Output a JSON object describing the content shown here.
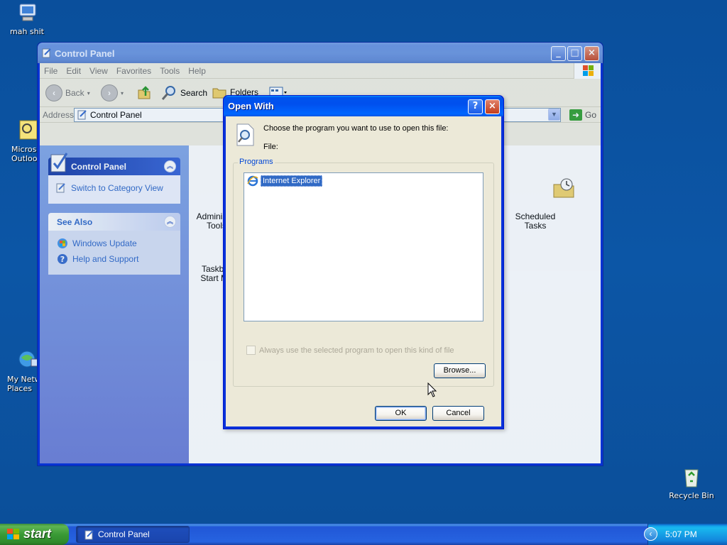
{
  "desktop": {
    "icons": [
      {
        "label": "mah shit",
        "icon": "my-computer-icon"
      },
      {
        "label": "Microsc\nOutloo",
        "icon": "outlook-icon"
      },
      {
        "label": "My Netw\nPlaces",
        "icon": "network-places-icon"
      },
      {
        "label": "Recycle Bin",
        "icon": "recycle-bin-icon"
      }
    ]
  },
  "explorer": {
    "title": "Control Panel",
    "menu": [
      "File",
      "Edit",
      "View",
      "Favorites",
      "Tools",
      "Help"
    ],
    "toolbar": {
      "back": "Back",
      "search": "Search",
      "folders": "Folders"
    },
    "address": {
      "label": "Address",
      "value": "Control Panel",
      "go": "Go"
    },
    "tasks": {
      "panel1": {
        "title": "Control Panel",
        "link": "Switch to Category View"
      },
      "panel2": {
        "title": "See Also",
        "links": [
          "Windows Update",
          "Help and Support"
        ]
      }
    },
    "items": [
      {
        "label": "Administra\nTools"
      },
      {
        "label": "Taskbar\nStart Me"
      },
      {
        "label": "Scheduled\nTasks"
      }
    ]
  },
  "dialog": {
    "title": "Open With",
    "prompt": "Choose the program you want to use to open this file:",
    "file_label": "File:",
    "group_label": "Programs",
    "programs": [
      "Internet Explorer"
    ],
    "always_use": "Always use the selected program to open this kind of file",
    "browse": "Browse...",
    "ok": "OK",
    "cancel": "Cancel"
  },
  "taskbar": {
    "start": "start",
    "task": "Control Panel",
    "clock": "5:07 PM"
  },
  "colors": {
    "desktop": "#0b4f9a",
    "dialog_title": "#0054e3",
    "selection": "#316ac5"
  }
}
